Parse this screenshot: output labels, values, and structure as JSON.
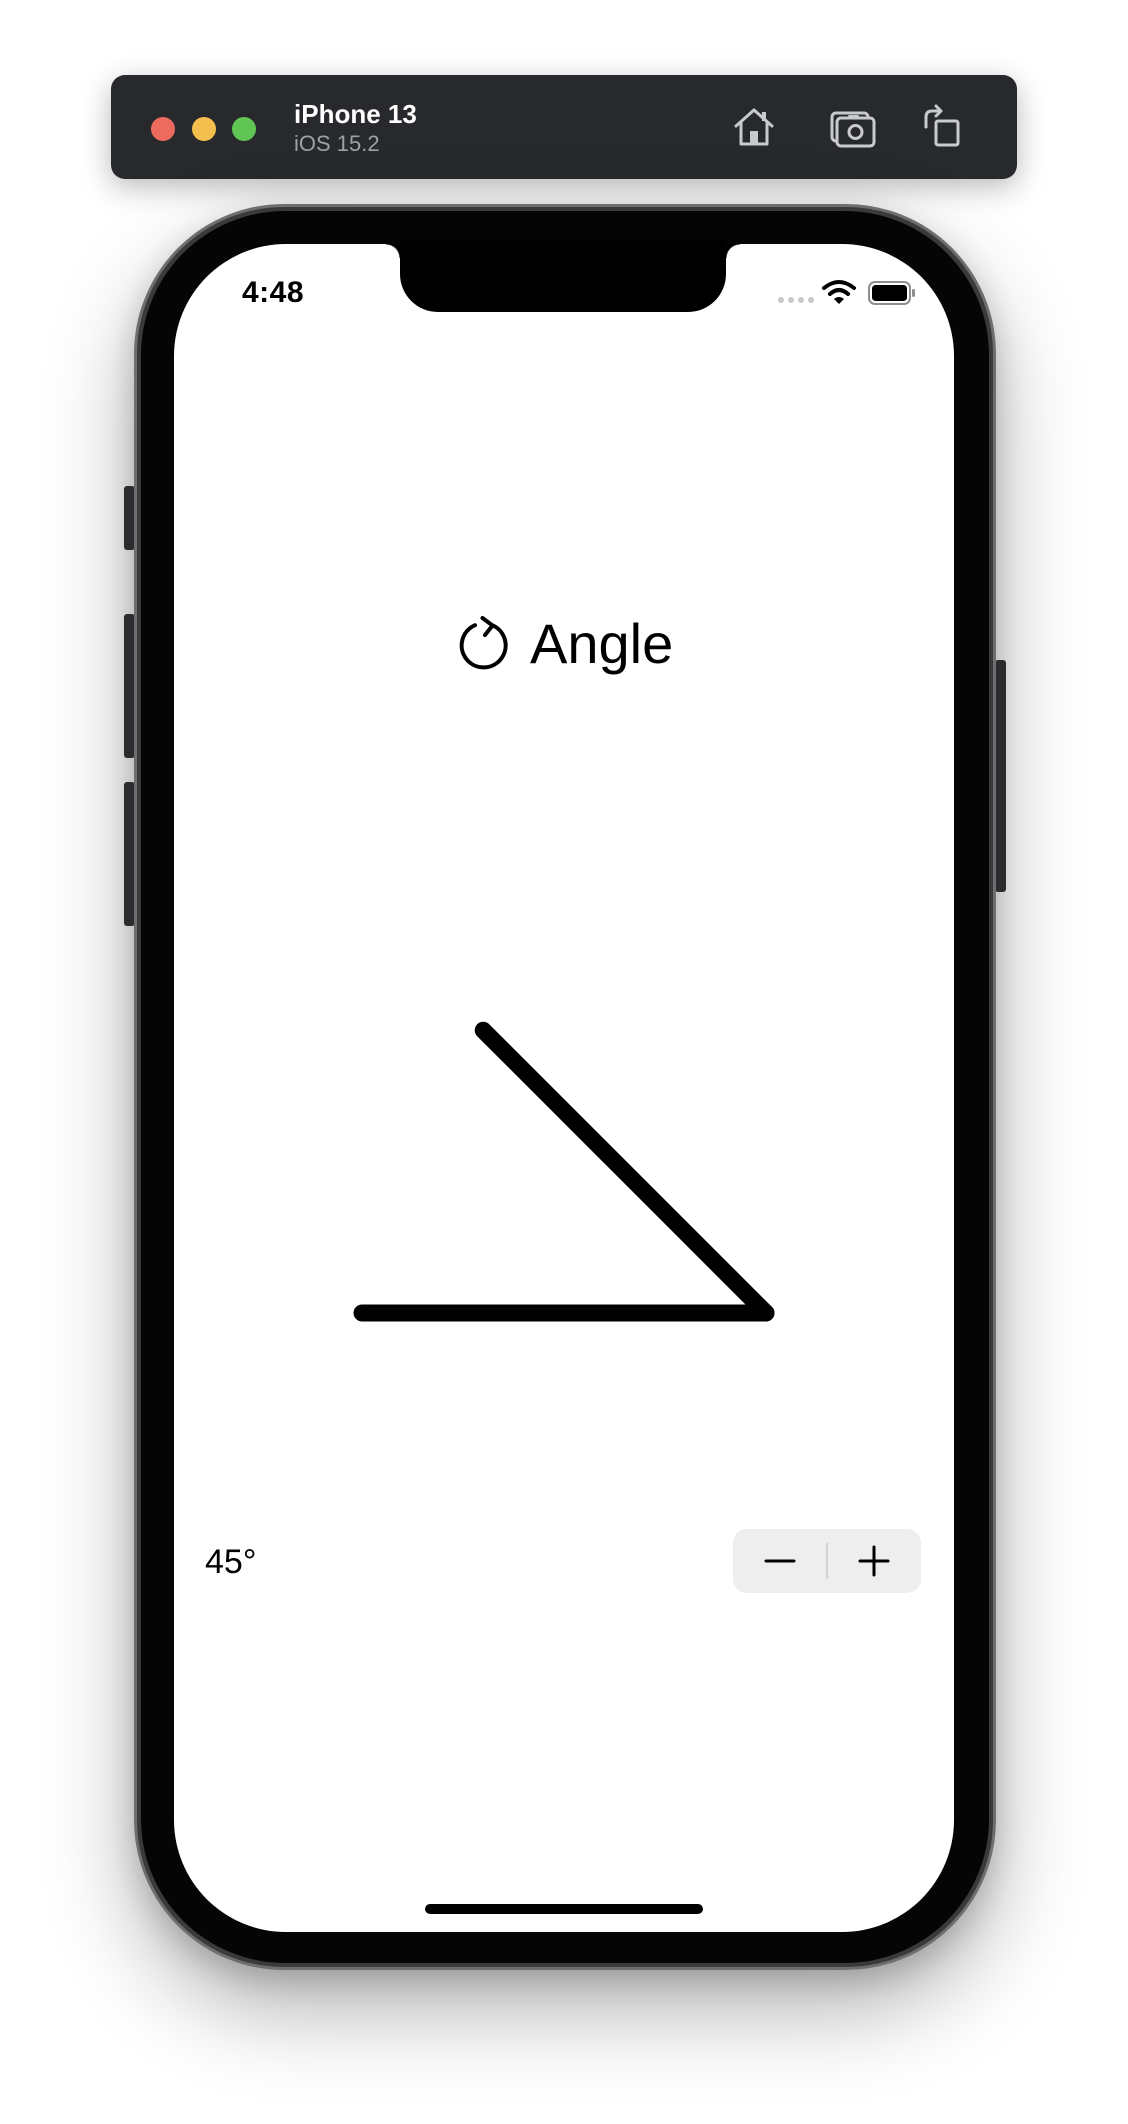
{
  "simulator": {
    "device_name": "iPhone 13",
    "os_version": "iOS 15.2",
    "toolbar_icons": [
      "home-icon",
      "screenshot-icon",
      "rotate-device-icon"
    ],
    "window_controls": [
      "close",
      "minimize",
      "zoom"
    ]
  },
  "status_bar": {
    "time": "4:48",
    "icons": [
      "cellular-signal-icon",
      "wifi-icon",
      "battery-icon"
    ]
  },
  "app": {
    "title": "Angle",
    "title_icon": "rotate-clockwise-icon",
    "angle_value": 45,
    "angle_label": "45°",
    "stepper": {
      "decrement_icon": "minus-icon",
      "increment_icon": "plus-icon"
    }
  },
  "colors": {
    "toolbar_bg": "#27292c",
    "close": "#ec6a5e",
    "minimize": "#f4bf4f",
    "zoom": "#61c554",
    "stepper_bg": "#eeeeef",
    "ink": "#000000"
  }
}
